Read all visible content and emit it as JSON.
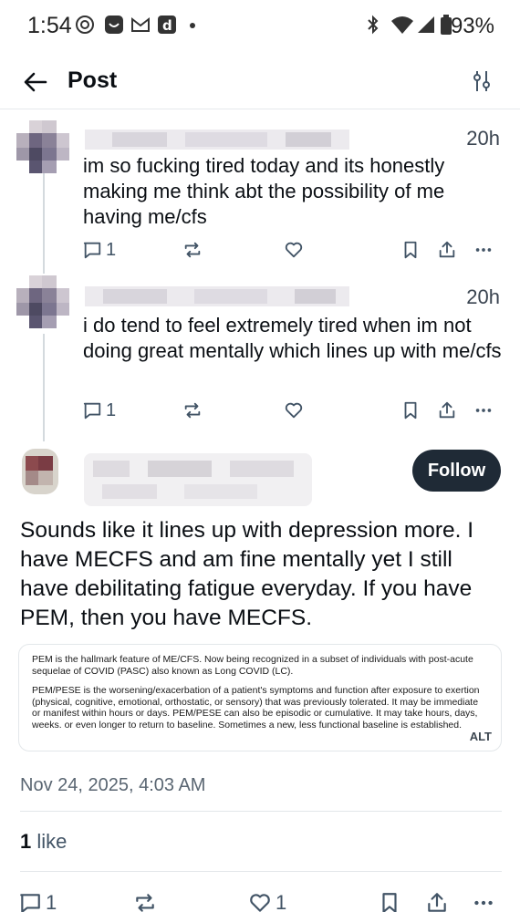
{
  "status_bar": {
    "time": "1:54",
    "battery": "93%",
    "left_icons": [
      "threads-icon",
      "app-face-icon",
      "gmail-icon",
      "d-app-icon",
      "dot-icon"
    ],
    "right_icons": [
      "bluetooth-icon",
      "wifi-icon",
      "signal-icon",
      "battery-icon"
    ]
  },
  "header": {
    "title": "Post"
  },
  "thread": [
    {
      "time": "20h",
      "text": "im so fucking tired today and its honestly making me think abt the possibility of me having me/cfs",
      "reply_count": "1"
    },
    {
      "time": "20h",
      "text": "i do tend to feel extremely tired when im not doing great mentally which lines up with me/cfs",
      "reply_count": "1"
    }
  ],
  "main_post": {
    "follow_label": "Follow",
    "text": "Sounds like it lines up with depression more. I have MECFS and am fine mentally yet I still have debilitating fatigue everyday. If you have PEM, then you have MECFS.",
    "image": {
      "paragraph_1": "PEM is the hallmark feature of ME/CFS. Now being recognized in a subset of individuals with post-acute sequelae of COVID (PASC) also known as Long COVID (LC).",
      "paragraph_2": "PEM/PESE is the worsening/exacerbation of a patient's symptoms and function after exposure to exertion (physical, cognitive, emotional, orthostatic, or sensory) that was previously tolerated. It may be immediate or manifest within hours or days. PEM/PESE can also be episodic or cumulative. It may take hours, days, weeks. or even longer to return to baseline. Sometimes a new, less functional baseline is established.",
      "alt_label": "ALT"
    },
    "timestamp": "Nov 24, 2025, 4:03 AM",
    "like_count": "1",
    "like_word": "like",
    "reply_count": "1",
    "like_count_action": "1"
  },
  "colors": {
    "accent_dark": "#1f2a36",
    "icon_gray": "#425466",
    "divider": "#e3e7ea"
  }
}
